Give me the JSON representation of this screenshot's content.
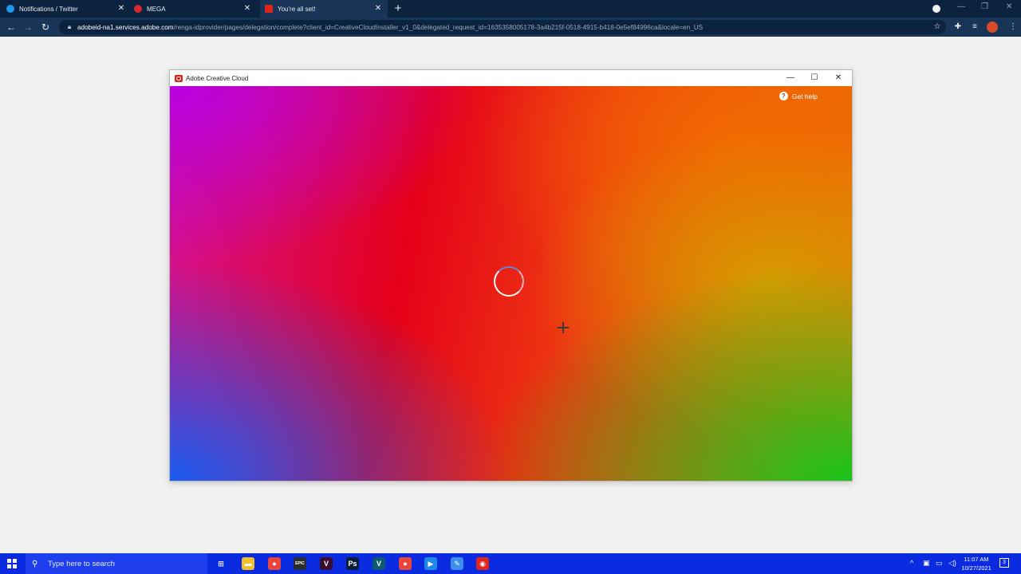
{
  "browser": {
    "tabs": [
      {
        "title": "Notifications / Twitter",
        "favicon_color": "#1d9bf0"
      },
      {
        "title": "MEGA",
        "favicon_color": "#d9272e"
      },
      {
        "title": "You're all set!",
        "favicon_color": "#e1251b"
      }
    ],
    "url_host": "adobeid-na1.services.adobe.com",
    "url_path": "/renga-idprovider/pages/delegation/complete?client_id=CreativeCloudInstaller_v1_0&delegated_request_id=1635358005178-3a4b215f-0518-4915-b418-0e5ef84996ca&locale=en_US"
  },
  "app_window": {
    "title": "Adobe Creative Cloud",
    "help_label": "Get help",
    "gradient_colors": [
      "#b800e0",
      "#e5001a",
      "#f26a00",
      "#d69b00",
      "#18c41a",
      "#1a5cf0"
    ]
  },
  "taskbar": {
    "search_placeholder": "Type here to search",
    "time": "11:07 AM",
    "date": "10/27/2021",
    "notification_count": "3",
    "apps": [
      {
        "name": "task-view",
        "glyph": "⊞",
        "color": "transparent"
      },
      {
        "name": "file-explorer",
        "glyph": "▬",
        "color": "#f3c02b"
      },
      {
        "name": "chrome",
        "glyph": "●",
        "color": "#e8453c"
      },
      {
        "name": "epic-games",
        "glyph": "EPIC",
        "color": "#2b2b2b"
      },
      {
        "name": "premiere",
        "glyph": "V",
        "color": "#3b0d2c"
      },
      {
        "name": "photoshop",
        "glyph": "Ps",
        "color": "#0a1e3c"
      },
      {
        "name": "vegas",
        "glyph": "V",
        "color": "#0c5a6e"
      },
      {
        "name": "chrome-2",
        "glyph": "●",
        "color": "#e8453c"
      },
      {
        "name": "media-app",
        "glyph": "▶",
        "color": "#1e88e5"
      },
      {
        "name": "notes-app",
        "glyph": "✎",
        "color": "#3b8eea"
      },
      {
        "name": "creative-cloud",
        "glyph": "◉",
        "color": "#e1251b"
      }
    ]
  }
}
